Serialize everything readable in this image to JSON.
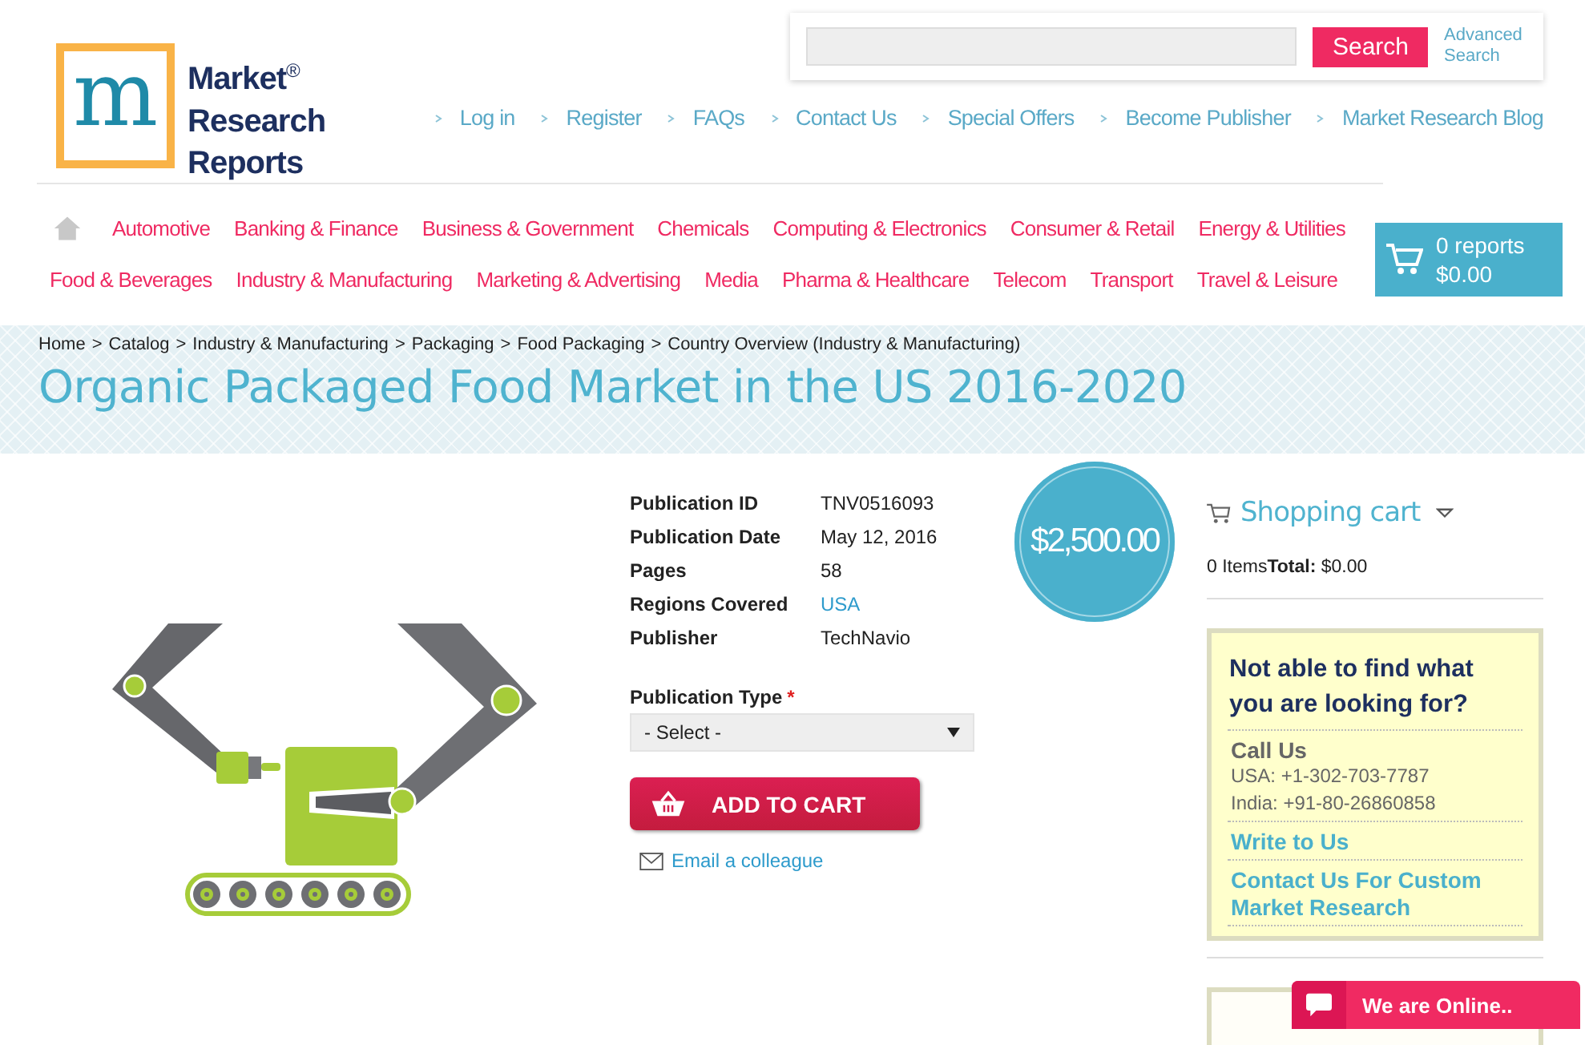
{
  "logo": {
    "mark": "m",
    "lines": [
      "Market",
      "Research",
      "Reports"
    ],
    "registered": "®"
  },
  "search": {
    "button": "Search",
    "advanced": "Advanced Search"
  },
  "top_links": [
    "Log in",
    "Register",
    "FAQs",
    "Contact Us",
    "Special Offers",
    "Become Publisher",
    "Market Research Blog"
  ],
  "category_rows": [
    [
      "Automotive",
      "Banking & Finance",
      "Business & Government",
      "Chemicals",
      "Computing & Electronics",
      "Consumer & Retail",
      "Energy & Utilities"
    ],
    [
      "Food & Beverages",
      "Industry & Manufacturing",
      "Marketing & Advertising",
      "Media",
      "Pharma & Healthcare",
      "Telecom",
      "Transport",
      "Travel & Leisure"
    ]
  ],
  "cart_button": {
    "count": "0 reports",
    "total": "$0.00"
  },
  "breadcrumb": [
    "Home",
    "Catalog",
    "Industry & Manufacturing",
    "Packaging",
    "Food Packaging",
    "Country Overview (Industry & Manufacturing)"
  ],
  "breadcrumb_separator": ">",
  "title": "Organic Packaged Food Market in the US 2016-2020",
  "details": [
    {
      "label": "Publication ID",
      "value": "TNV0516093",
      "kind": "text"
    },
    {
      "label": "Publication Date",
      "value": "May 12, 2016",
      "kind": "text"
    },
    {
      "label": "Pages",
      "value": "58",
      "kind": "text"
    },
    {
      "label": "Regions Covered",
      "value": "USA",
      "kind": "link"
    },
    {
      "label": "Publisher",
      "value": "TechNavio",
      "kind": "text"
    }
  ],
  "price": "$2,500.00",
  "publication_type": {
    "label": "Publication Type",
    "required_mark": "*",
    "select": "- Select -"
  },
  "add_to_cart": "ADD TO CART",
  "email": "Email a colleague",
  "sidebar": {
    "cart_title": "Shopping cart",
    "items": "0 Items",
    "total_label": "Total:",
    "total": "$0.00"
  },
  "help": {
    "heading": "Not able to find what you are looking for?",
    "call_title": "Call Us",
    "phones": [
      "USA: +1-302-703-7787",
      "India: +91-80-26860858"
    ],
    "links": [
      "Write to Us",
      "Contact Us For Custom Market Research"
    ]
  },
  "chat": "We are Online.."
}
